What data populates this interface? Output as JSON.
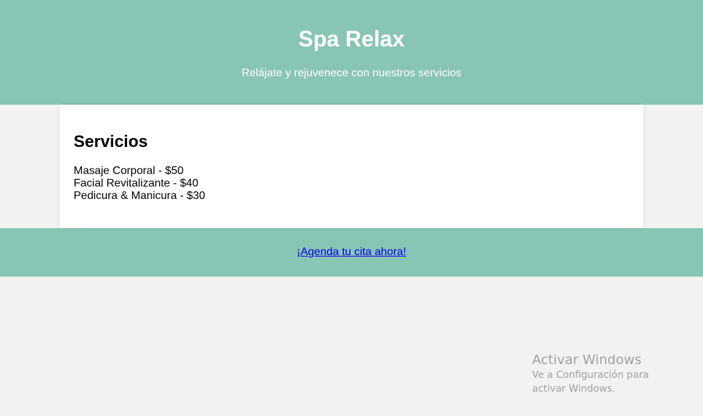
{
  "header": {
    "title": "Spa Relax",
    "subtitle": "Relájate y rejuvenece con nuestros servicios"
  },
  "services": {
    "heading": "Servicios",
    "items": [
      "Masaje Corporal - $50",
      "Facial Revitalizante - $40",
      "Pedicura & Manicura - $30"
    ]
  },
  "footer": {
    "cta_label": "¡Agenda tu cita ahora!"
  },
  "watermark": {
    "title": "Activar Windows",
    "subtitle": "Ve a Configuración para activar Windows."
  },
  "colors": {
    "accent": "#89c5b4",
    "background": "#f2f2f2",
    "link": "#0000ee"
  }
}
